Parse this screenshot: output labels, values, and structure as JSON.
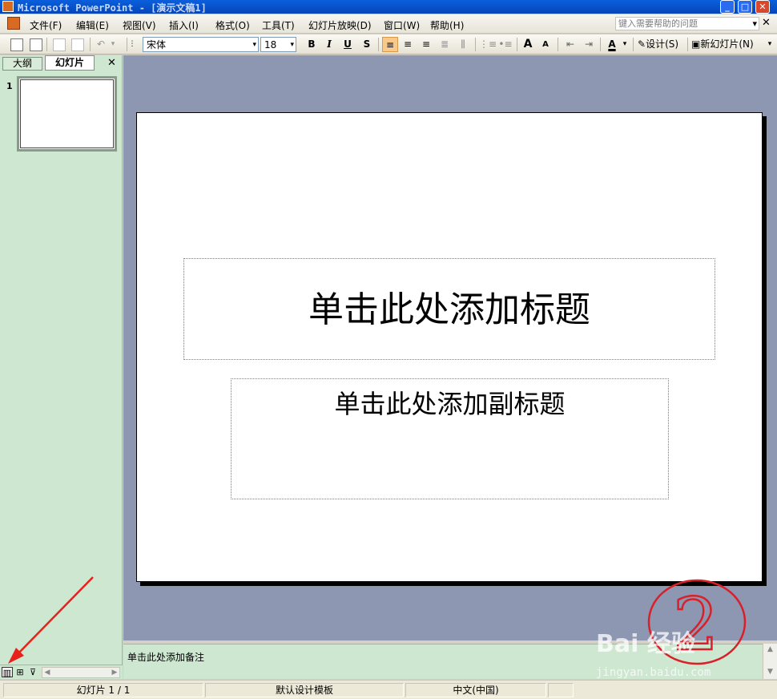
{
  "window": {
    "title": "Microsoft PowerPoint - [演示文稿1]",
    "minimize": "_",
    "maximize": "□",
    "close": "✕"
  },
  "menubar": {
    "items": [
      "文件(F)",
      "编辑(E)",
      "视图(V)",
      "插入(I)",
      "格式(O)",
      "工具(T)",
      "幻灯片放映(D)",
      "窗口(W)",
      "帮助(H)"
    ],
    "help_placeholder": "键入需要帮助的问题",
    "help_arrow": "▾",
    "doc_close": "✕"
  },
  "toolbar": {
    "font_name": "宋体",
    "font_size": "18",
    "bold": "B",
    "italic": "I",
    "underline": "U",
    "shadow": "S",
    "increase_font": "A",
    "decrease_font": "A",
    "font_color": "A",
    "design_label": "设计(S)",
    "new_slide_label": "新幻灯片(N)",
    "dropdown_arrow": "▾"
  },
  "left_pane": {
    "tabs": [
      "大纲",
      "幻灯片"
    ],
    "active_tab": "幻灯片",
    "close": "✕",
    "slide_number": "1"
  },
  "slide": {
    "title_placeholder": "单击此处添加标题",
    "subtitle_placeholder": "单击此处添加副标题"
  },
  "notes": {
    "placeholder": "单击此处添加备注"
  },
  "statusbar": {
    "slide_info": "幻灯片 1 / 1",
    "template": "默认设计模板",
    "language": "中文(中国)"
  },
  "annotations": {
    "circled_number": "2",
    "watermark": "Bai 经验",
    "watermark_url": "jingyan.baidu.com",
    "arrow_color": "#e8221a",
    "circle_color": "#d8202a"
  },
  "icons": {
    "view_normal": "normal-view-icon",
    "view_sorter": "slide-sorter-icon",
    "view_show": "slide-show-icon"
  }
}
